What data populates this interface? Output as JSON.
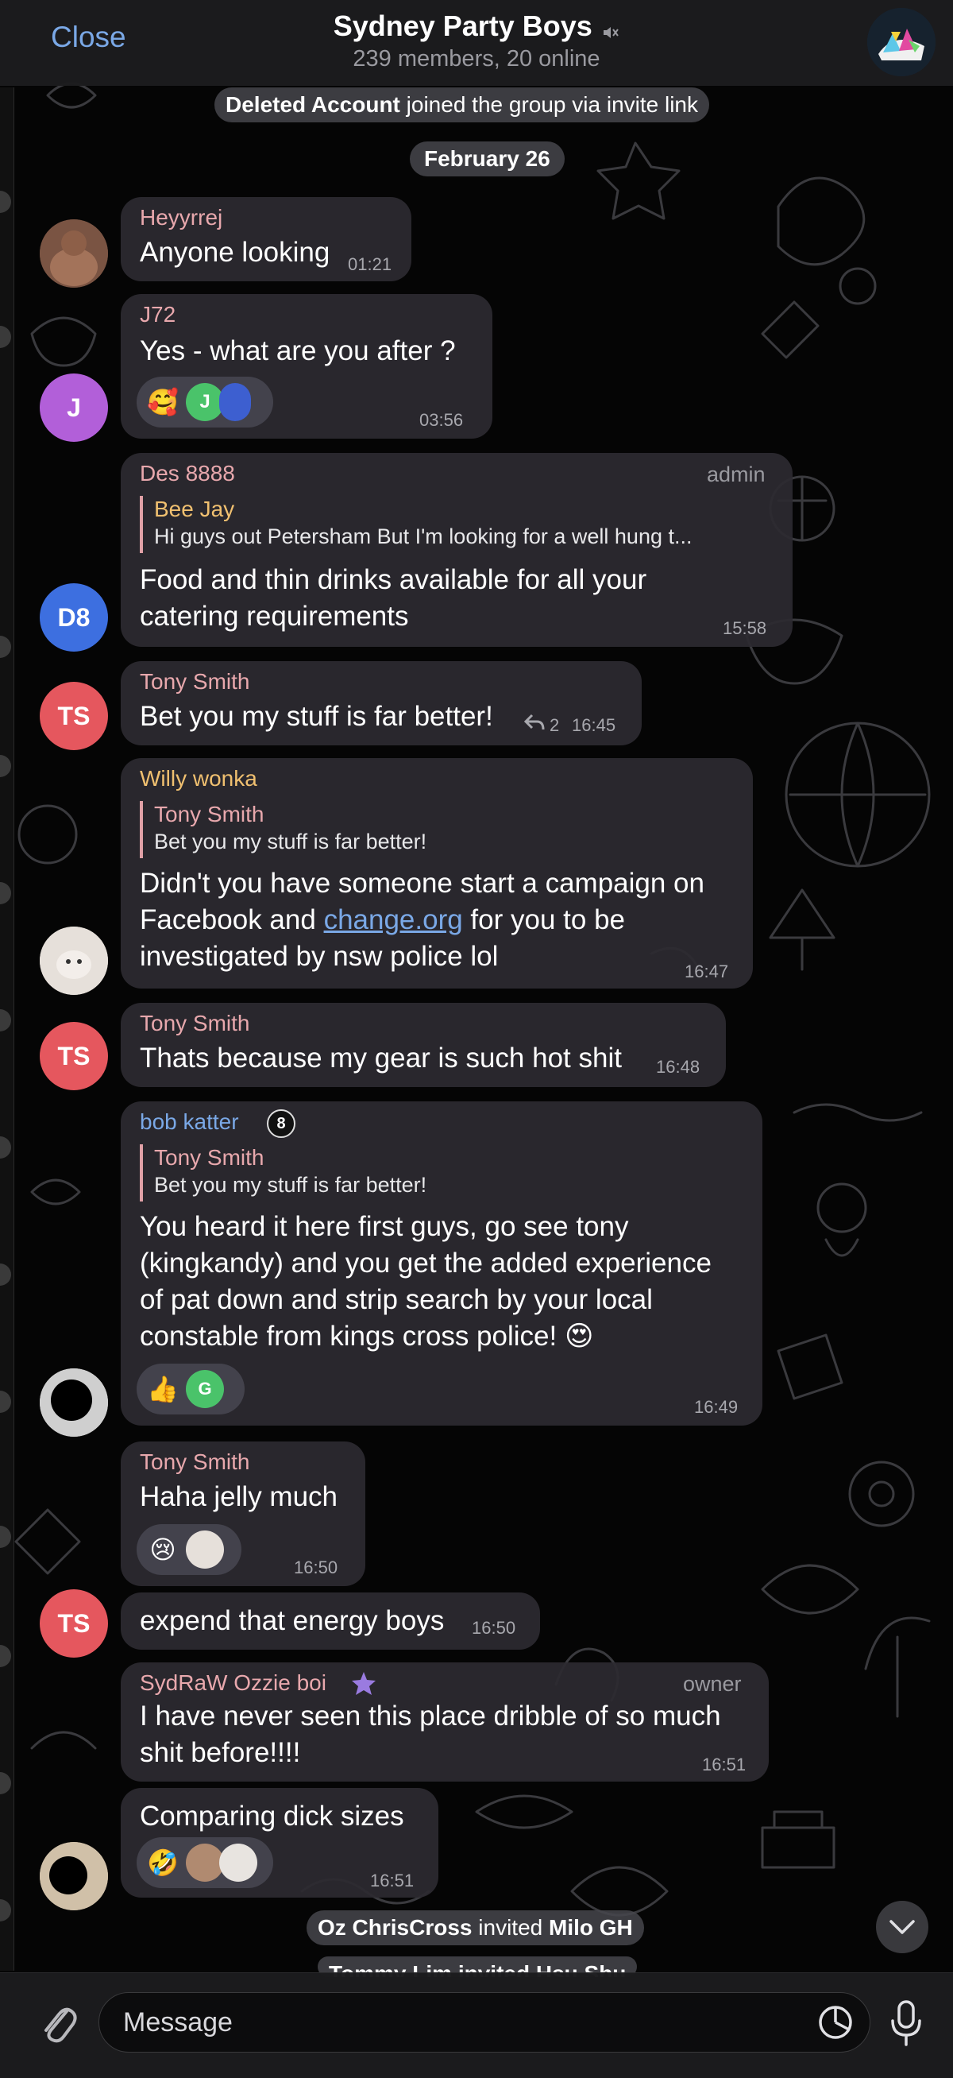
{
  "header": {
    "close_label": "Close",
    "title": "Sydney Party Boys",
    "subtitle": "239 members, 20 online"
  },
  "service": {
    "joined_name": "Deleted Account",
    "joined_text": "joined the group via invite link",
    "date": "February 26",
    "invite1_from": "Oz ChrisCross",
    "invite1_verb": "invited",
    "invite1_to": "Milo GH",
    "invite2_partial": "Tommy Lim invited Hsu Shu"
  },
  "messages": [
    {
      "sender": "Heyyrrej",
      "text": "Anyone looking",
      "time": "01:21"
    },
    {
      "sender": "J72",
      "text": "Yes - what are you after ?",
      "time": "03:56",
      "avatar_letter": "J",
      "reaction_emoji": "🥰",
      "reaction_letter": "J"
    },
    {
      "sender": "Des 8888",
      "role": "admin",
      "reply_name": "Bee Jay",
      "reply_text": "Hi guys out Petersham But I'm looking for a well hung t...",
      "text_line1": "Food and thin drinks available for all your",
      "text_line2": "catering requirements",
      "time": "15:58",
      "avatar_letter": "D8"
    },
    {
      "sender": "Tony Smith",
      "text": "Bet you my stuff is far better!",
      "replies": "2",
      "time": "16:45",
      "avatar_letter": "TS"
    },
    {
      "sender": "Willy wonka",
      "reply_name": "Tony Smith",
      "reply_text": "Bet you my stuff is far better!",
      "text_line1": "Didn't you have someone start a campaign on",
      "text_line2_a": "Facebook and ",
      "text_line2_link": "change.org",
      "text_line2_b": " for you to be",
      "text_line3": "investigated by nsw police lol",
      "time": "16:47"
    },
    {
      "sender": "Tony Smith",
      "text": "Thats because my gear is such hot shit",
      "time": "16:48",
      "avatar_letter": "TS"
    },
    {
      "sender": "bob katter",
      "badge": "8",
      "reply_name": "Tony Smith",
      "reply_text": "Bet you my stuff is far better!",
      "text_line1": "You heard it here first guys, go see tony",
      "text_line2": "(kingkandy) and you get the added experience",
      "text_line3": "of pat down and strip search by your local",
      "text_line4": "constable from kings cross police! 😍",
      "time": "16:49",
      "reaction_emoji": "👍",
      "reaction_letter": "G"
    },
    {
      "sender": "Tony Smith",
      "text": "Haha jelly much",
      "time": "16:50",
      "reaction_emoji": "😢"
    },
    {
      "text": "expend that energy boys",
      "time": "16:50",
      "avatar_letter": "TS"
    },
    {
      "sender": "SydRaW Ozzie boi",
      "role": "owner",
      "text_line1": "I have never seen this place dribble of so much",
      "text_line2": "shit before!!!!",
      "time": "16:51"
    },
    {
      "text": "Comparing dick sizes",
      "time": "16:51",
      "reaction_emoji": "🤣"
    }
  ],
  "input": {
    "placeholder": "Message"
  },
  "colors": {
    "accent": "#7aa8e6",
    "sender_pink": "#e8a8ad",
    "avatar_ts": "#e5575e",
    "avatar_d8": "#3d6fe0",
    "avatar_j": "#b25fd9",
    "bubble": "#2c2a30"
  }
}
